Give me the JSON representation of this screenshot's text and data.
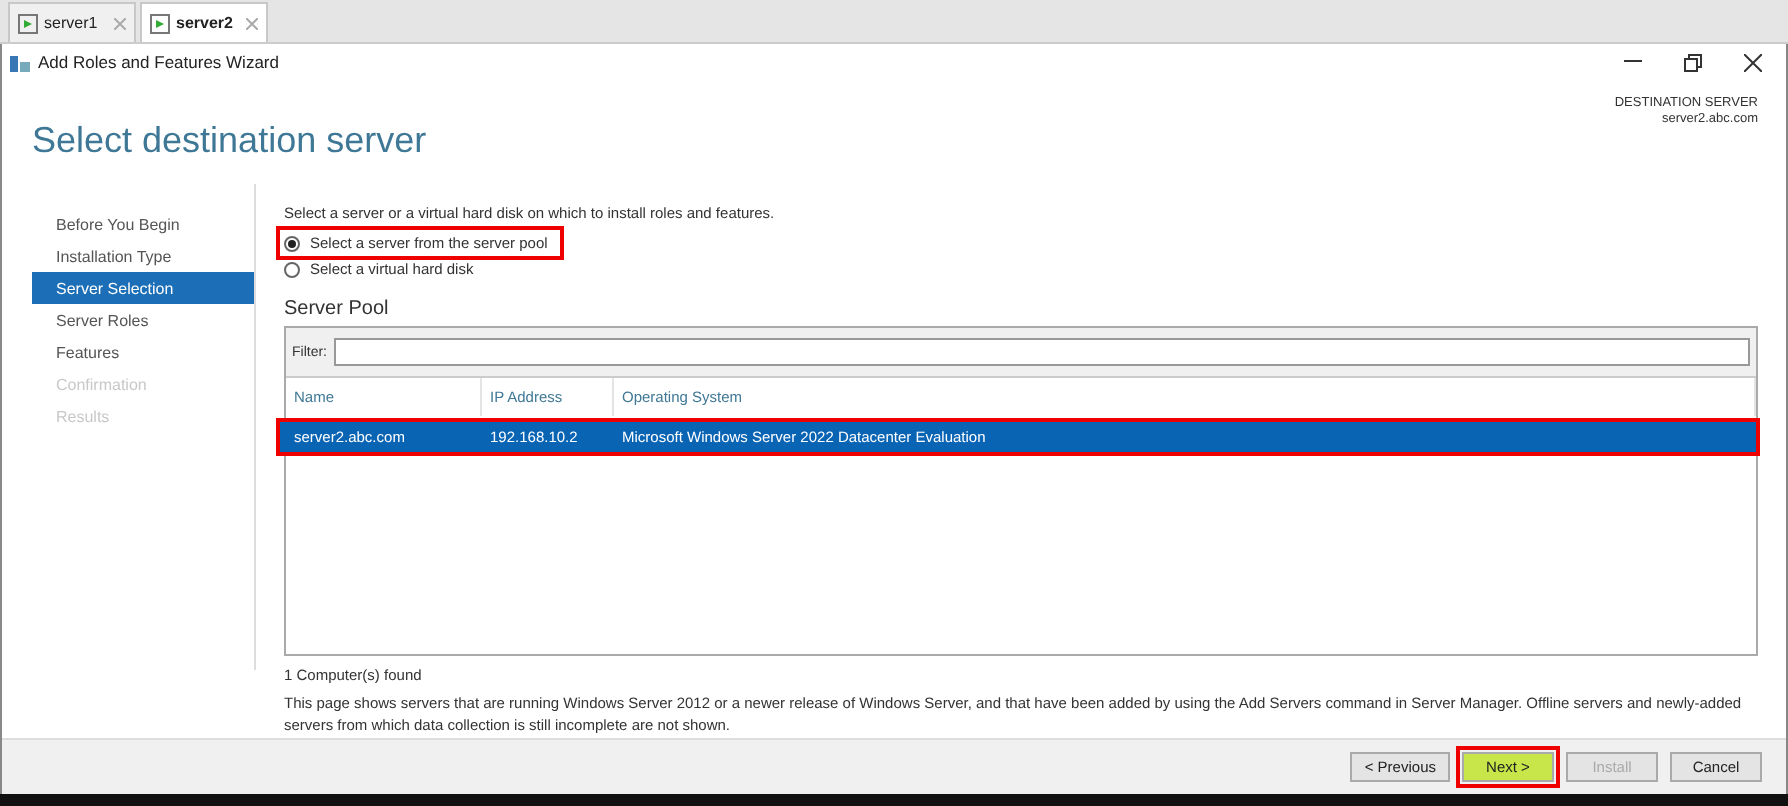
{
  "tabs": [
    {
      "label": "server1",
      "selected": false
    },
    {
      "label": "server2",
      "selected": true
    }
  ],
  "window": {
    "title": "Add Roles and Features Wizard"
  },
  "heading": "Select destination server",
  "destination": {
    "label": "DESTINATION SERVER",
    "value": "server2.abc.com"
  },
  "steps": [
    {
      "label": "Before You Begin",
      "selected": false,
      "disabled": false
    },
    {
      "label": "Installation Type",
      "selected": false,
      "disabled": false
    },
    {
      "label": "Server Selection",
      "selected": true,
      "disabled": false
    },
    {
      "label": "Server Roles",
      "selected": false,
      "disabled": false
    },
    {
      "label": "Features",
      "selected": false,
      "disabled": false
    },
    {
      "label": "Confirmation",
      "selected": false,
      "disabled": true
    },
    {
      "label": "Results",
      "selected": false,
      "disabled": true
    }
  ],
  "intro": "Select a server or a virtual hard disk on which to install roles and features.",
  "options": [
    {
      "label": "Select a server from the server pool",
      "selected": true,
      "highlighted": true
    },
    {
      "label": "Select a virtual hard disk",
      "selected": false,
      "highlighted": false
    }
  ],
  "pool": {
    "title": "Server Pool",
    "filter_label": "Filter:",
    "columns": [
      "Name",
      "IP Address",
      "Operating System"
    ],
    "rows": [
      {
        "cells": [
          "server2.abc.com",
          "192.168.10.2",
          "Microsoft Windows Server 2022 Datacenter Evaluation"
        ],
        "selected": true,
        "highlighted": true
      }
    ]
  },
  "found": "1 Computer(s) found",
  "note": "This page shows servers that are running Windows Server 2012 or a newer release of Windows Server, and that have been added by using the Add Servers command in Server Manager. Offline servers and newly-added servers from which data collection is still incomplete are not shown.",
  "buttons": [
    {
      "label": "< Previous",
      "disabled": false,
      "highlighted": false
    },
    {
      "label": "Next >",
      "disabled": false,
      "highlighted": true
    },
    {
      "label": "Install",
      "disabled": true,
      "highlighted": false
    },
    {
      "label": "Cancel",
      "disabled": false,
      "highlighted": false
    }
  ]
}
